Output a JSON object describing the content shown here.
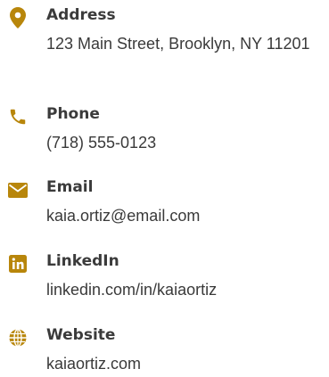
{
  "accent_color": "#b8860b",
  "contacts": [
    {
      "icon": "map-marker-icon",
      "label": "Address",
      "value": "123 Main Street, Brooklyn, NY 11201"
    },
    {
      "icon": "phone-icon",
      "label": "Phone",
      "value": "(718) 555-0123"
    },
    {
      "icon": "envelope-icon",
      "label": "Email",
      "value": "kaia.ortiz@email.com"
    },
    {
      "icon": "linkedin-icon",
      "label": "LinkedIn",
      "value": "linkedin.com/in/kaiaortiz"
    },
    {
      "icon": "globe-icon",
      "label": "Website",
      "value": "kaiaortiz.com"
    }
  ]
}
